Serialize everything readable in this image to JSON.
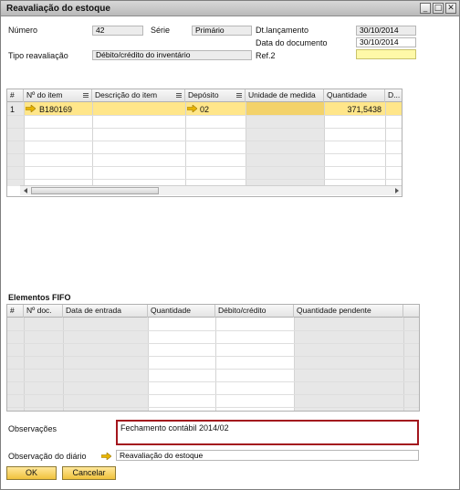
{
  "window": {
    "title": "Reavaliação do estoque",
    "controls": [
      "_",
      "□",
      "✕"
    ]
  },
  "header": {
    "numero_label": "Número",
    "numero_value": "42",
    "serie_label": "Série",
    "serie_value": "Primário",
    "dt_lancamento_label": "Dt.lançamento",
    "dt_lancamento_value": "30/10/2014",
    "data_documento_label": "Data do documento",
    "data_documento_value": "30/10/2014",
    "tipo_reavaliacao_label": "Tipo reavaliação",
    "tipo_reavaliacao_value": "Débito/crédito do inventário",
    "ref2_label": "Ref.2",
    "ref2_value": ""
  },
  "items_grid": {
    "columns": [
      "#",
      "Nº do item",
      "Descrição do item",
      "Depósito",
      "Unidade de medida",
      "Quantidade",
      "D..."
    ],
    "rows": [
      {
        "num": "1",
        "item": "B180169",
        "descricao": "",
        "deposito": "02",
        "unidade": "",
        "quantidade": "371,5438",
        "d": ""
      }
    ]
  },
  "fifo": {
    "title": "Elementos FIFO",
    "columns": [
      "#",
      "Nº doc.",
      "Data de entrada",
      "Quantidade",
      "Débito/crédito",
      "Quantidade pendente"
    ]
  },
  "footer": {
    "observacoes_label": "Observações",
    "observacoes_value": "Fechamento contábil 2014/02",
    "obs_diario_label": "Observação do diário",
    "obs_diario_value": "Reavaliação do estoque",
    "ok_label": "OK",
    "cancel_label": "Cancelar"
  },
  "colors": {
    "selected_row": "#ffe68a",
    "button": "#f0c23c",
    "highlight_border": "#a3161d",
    "link_arrow": "#e8b400"
  }
}
